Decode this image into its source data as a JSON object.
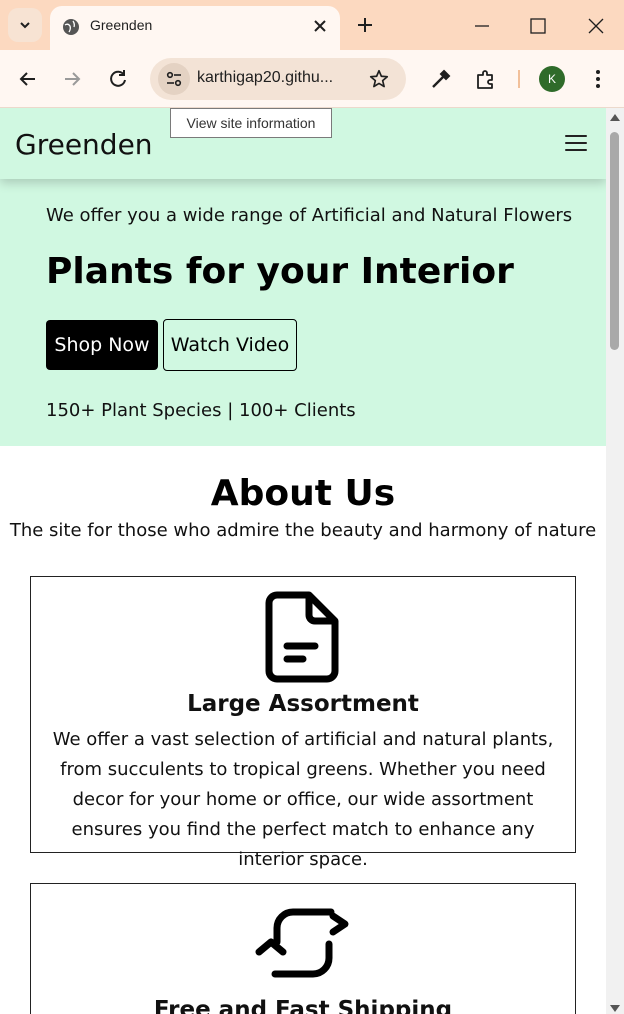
{
  "browser": {
    "tab_title": "Greenden",
    "url": "karthigap20.githu...",
    "tooltip": "View site information",
    "profile_initial": "K",
    "colors": {
      "tabbar": "#fcd9c0",
      "toolbar": "#fff7f2",
      "avatar": "#2f6b2a"
    }
  },
  "navbar": {
    "brand": "Greenden",
    "menu_icon": "hamburger-icon"
  },
  "hero": {
    "subtitle": "We offer you a wide range of Artificial and Natural Flowers",
    "title": "Plants for your Interior",
    "shop_label": "Shop Now",
    "watch_label": "Watch Video",
    "stats": "150+ Plant Species | 100+ Clients",
    "background": "#d0f8e1"
  },
  "about": {
    "title": "About Us",
    "subtitle": "The site for those who admire the beauty and harmony of nature",
    "cards": [
      {
        "icon": "document-icon",
        "title": "Large Assortment",
        "text": "We offer a vast selection of artificial and natural plants, from succulents to tropical greens. Whether you need decor for your home or office, our wide assortment ensures you find the perfect match to enhance any interior space."
      },
      {
        "icon": "repeat-arrows-icon",
        "title": "Free and Fast Shipping",
        "text": ""
      }
    ]
  }
}
